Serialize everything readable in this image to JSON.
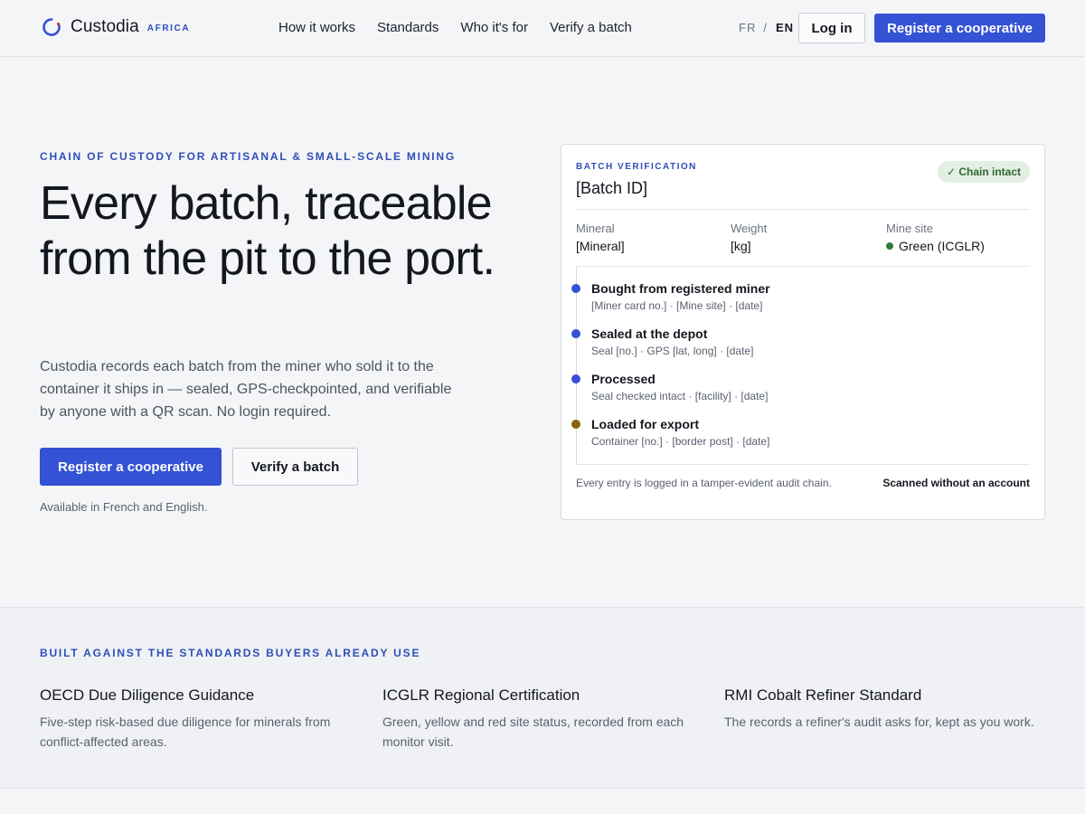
{
  "header": {
    "brand": "Custodia",
    "brand_sub": "AFRICA",
    "nav": [
      "How it works",
      "Standards",
      "Who it's for",
      "Verify a batch"
    ],
    "lang_fr": "FR",
    "lang_sep": "/",
    "lang_en": "EN",
    "login": "Log in",
    "register": "Register a cooperative"
  },
  "hero": {
    "eyebrow": "CHAIN OF CUSTODY FOR ARTISANAL & SMALL-SCALE MINING",
    "title": "Every batch, traceable from the pit to the port.",
    "body": "Custodia records each batch from the miner who sold it to the container it ships in — sealed, GPS-checkpointed, and verifiable by anyone with a QR scan. No login required.",
    "primary_cta": "Register a cooperative",
    "secondary_cta": "Verify a batch",
    "availability": "Available in French and English."
  },
  "card": {
    "eyebrow": "BATCH VERIFICATION",
    "batch_id": "[Batch ID]",
    "badge": "✓ Chain intact",
    "meta": [
      {
        "label": "Mineral",
        "value": "[Mineral]"
      },
      {
        "label": "Weight",
        "value": "[kg]"
      },
      {
        "label": "Mine site",
        "value": "Green (ICGLR)"
      }
    ],
    "steps": [
      {
        "title": "Bought from registered miner",
        "detail": "[Miner card no.] · [Mine site] · [date]",
        "color": "#3452d4"
      },
      {
        "title": "Sealed at the depot",
        "detail": "Seal [no.] · GPS [lat, long] · [date]",
        "color": "#3452d4"
      },
      {
        "title": "Processed",
        "detail": "Seal checked intact · [facility] · [date]",
        "color": "#3452d4"
      },
      {
        "title": "Loaded for export",
        "detail": "Container [no.] · [border post] · [date]",
        "color": "#8a6508"
      }
    ],
    "footer": "Every entry is logged in a tamper-evident audit chain.",
    "footer_right": "Scanned without an account"
  },
  "standards": {
    "eyebrow": "BUILT AGAINST THE STANDARDS BUYERS ALREADY USE",
    "items": [
      {
        "title": "OECD Due Diligence Guidance",
        "desc": "Five-step risk-based due diligence for minerals from conflict-affected areas."
      },
      {
        "title": "ICGLR Regional Certification",
        "desc": "Green, yellow and red site status, recorded from each monitor visit."
      },
      {
        "title": "RMI Cobalt Refiner Standard",
        "desc": "The records a refiner's audit asks for, kept as you work."
      }
    ]
  },
  "colors": {
    "accent": "#3452d4",
    "status_green": "#2e7d32",
    "export_marker": "#8a6508"
  }
}
